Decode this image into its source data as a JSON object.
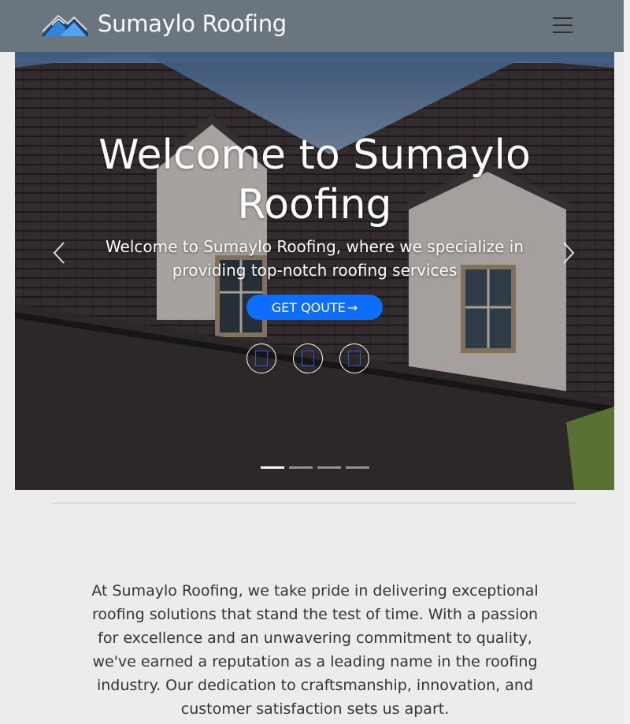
{
  "navbar": {
    "brand_name": "Sumaylo Roofing",
    "logo_icon": "mountain-roof-logo",
    "menu_icon": "hamburger-menu-icon",
    "background_color": "#6b757d"
  },
  "hero": {
    "title": "Welcome to Sumaylo Roofing",
    "subtitle": "Welcome to Sumaylo Roofing, where we specialize in providing top-notch roofing services",
    "cta_label": "GET QOUTE",
    "cta_arrow": "→",
    "cta_color": "#0d6efd",
    "social_icons": [
      "social-icon",
      "social-icon",
      "social-icon"
    ],
    "prev_icon": "chevron-left-icon",
    "next_icon": "chevron-right-icon",
    "slides_count": 4,
    "active_slide": 1
  },
  "about": {
    "text": "At Sumaylo Roofing, we take pride in delivering exceptional roofing solutions that stand the test of time. With a passion for excellence and an unwavering commitment to quality, we've earned a reputation as a leading name in the roofing industry. Our dedication to craftsmanship, innovation, and customer satisfaction sets us apart."
  }
}
